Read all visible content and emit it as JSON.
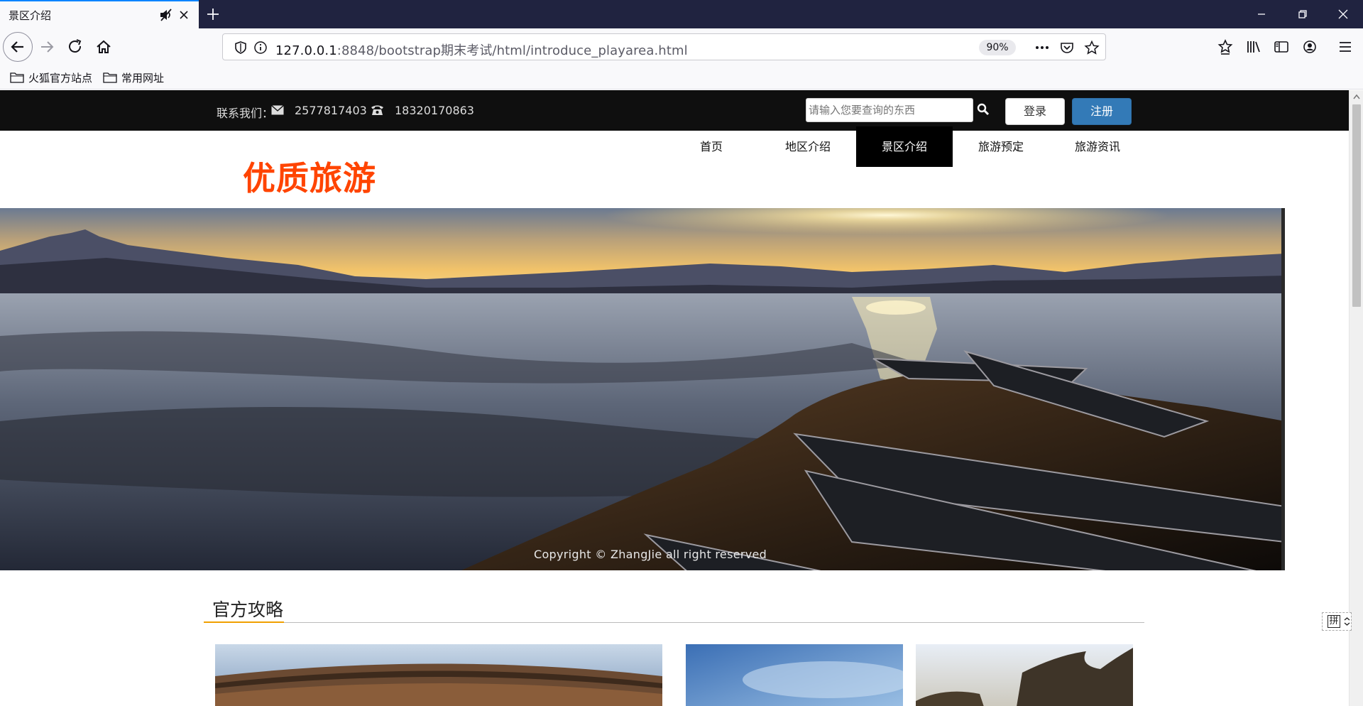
{
  "browser": {
    "tab_title": "景区介绍",
    "url_host": "127.0.0.1",
    "url_rest": ":8848/bootstrap期末考试/html/introduce_playarea.html",
    "zoom": "90%",
    "bookmarks": [
      "火狐官方站点",
      "常用网址"
    ]
  },
  "topbar": {
    "contact_label": "联系我们：",
    "email_number": "2577817403",
    "phone_number": "18320170863",
    "search_placeholder": "请输入您要查询的东西",
    "login_label": "登录",
    "register_label": "注册"
  },
  "header": {
    "brand": "优质旅游",
    "nav": [
      {
        "label": "首页",
        "active": false
      },
      {
        "label": "地区介绍",
        "active": false
      },
      {
        "label": "景区介绍",
        "active": true
      },
      {
        "label": "旅游预定",
        "active": false
      },
      {
        "label": "旅游资讯",
        "active": false
      }
    ]
  },
  "hero": {
    "caption": "Copyright © ZhangJie  all  right  reserved"
  },
  "section": {
    "title": "官方攻略"
  },
  "ime": {
    "label": "拼"
  },
  "colors": {
    "brand": "#ff4400",
    "topbar_bg": "#0f0f0f",
    "register": "#337ab7",
    "section_accent": "#f0a000"
  }
}
